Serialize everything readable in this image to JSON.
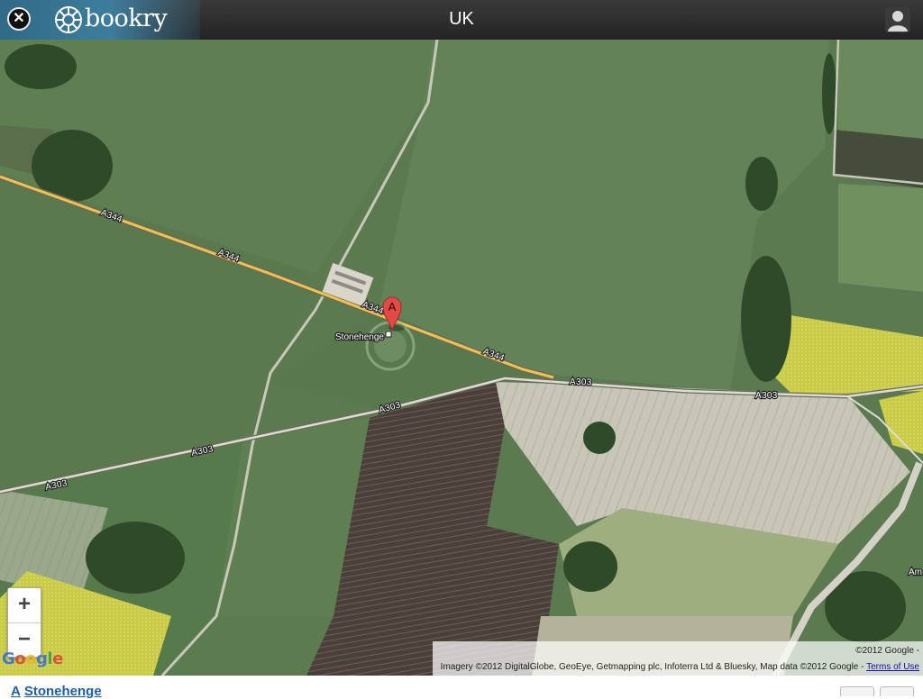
{
  "header": {
    "brand": "bookry",
    "title": "UK"
  },
  "map": {
    "marker_label": "A",
    "place_label": "Stonehenge",
    "roads": {
      "a344": "A344",
      "a303": "A303"
    },
    "zoom_in": "+",
    "zoom_out": "−",
    "google_logo": "Google",
    "copyright": "©2012 Google -",
    "attribution": "Imagery ©2012 DigitalGlobe, GeoEye, Getmapping plc, Infoterra Ltd & Bluesky, Map data ©2012 Google -",
    "terms_link": "Terms of Use",
    "edge_fragment": "Am"
  },
  "result": {
    "letter": "A",
    "name": "Stonehenge"
  },
  "colors": {
    "marker": "#e24b45",
    "road_major": "#f2c24b",
    "link": "#1e5ea8"
  }
}
